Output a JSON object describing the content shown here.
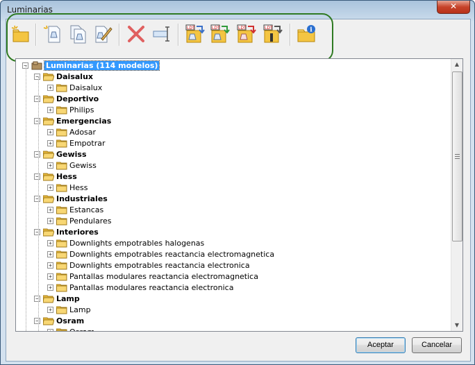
{
  "window": {
    "title": "Luminarias",
    "close_label": "✕"
  },
  "toolbar": {
    "buttons": [
      {
        "name": "new-folder",
        "icon": "new-folder-icon"
      },
      {
        "name": "new-luminaire",
        "icon": "new-luminaire-icon"
      },
      {
        "name": "copy-luminaire",
        "icon": "copy-luminaire-icon"
      },
      {
        "name": "edit-luminaire",
        "icon": "edit-luminaire-icon"
      },
      {
        "name": "delete",
        "icon": "delete-icon"
      },
      {
        "name": "rename",
        "icon": "rename-icon"
      },
      {
        "name": "import-ldt-1",
        "icon": "ldt-import-icon",
        "badge": "LDT"
      },
      {
        "name": "import-ldt-2",
        "icon": "ldt-import-icon",
        "badge": "LDT"
      },
      {
        "name": "import-ldt-3",
        "icon": "ldt-import-icon",
        "badge": "LDT"
      },
      {
        "name": "import-ldt-4",
        "icon": "ldt-import-icon",
        "badge": "LDT"
      },
      {
        "name": "info",
        "icon": "info-folder-icon"
      }
    ]
  },
  "tree": {
    "root": "Luminarias (114 modelos)",
    "nodes": [
      {
        "label": "Daisalux",
        "children": [
          "Daisalux"
        ]
      },
      {
        "label": "Deportivo",
        "children": [
          "Philips"
        ]
      },
      {
        "label": "Emergencias",
        "children": [
          "Adosar",
          "Empotrar"
        ]
      },
      {
        "label": "Gewiss",
        "children": [
          "Gewiss"
        ]
      },
      {
        "label": "Hess",
        "children": [
          "Hess"
        ]
      },
      {
        "label": "Industriales",
        "children": [
          "Estancas",
          "Pendulares"
        ]
      },
      {
        "label": "Interiores",
        "children": [
          "Downlights empotrables halogenas",
          "Downlights empotrables reactancia electromagnetica",
          "Downlights empotrables reactancia electronica",
          "Pantallas modulares reactancia electromagnetica",
          "Pantallas modulares reactancia electronica"
        ]
      },
      {
        "label": "Lamp",
        "children": [
          "Lamp"
        ]
      },
      {
        "label": "Osram",
        "children": [
          "Osram"
        ]
      }
    ]
  },
  "buttons": {
    "accept": "Aceptar",
    "cancel": "Cancelar"
  },
  "colors": {
    "selection": "#3399ff",
    "folder": "#f2c94c",
    "highlight_ring": "#2f7a22"
  }
}
